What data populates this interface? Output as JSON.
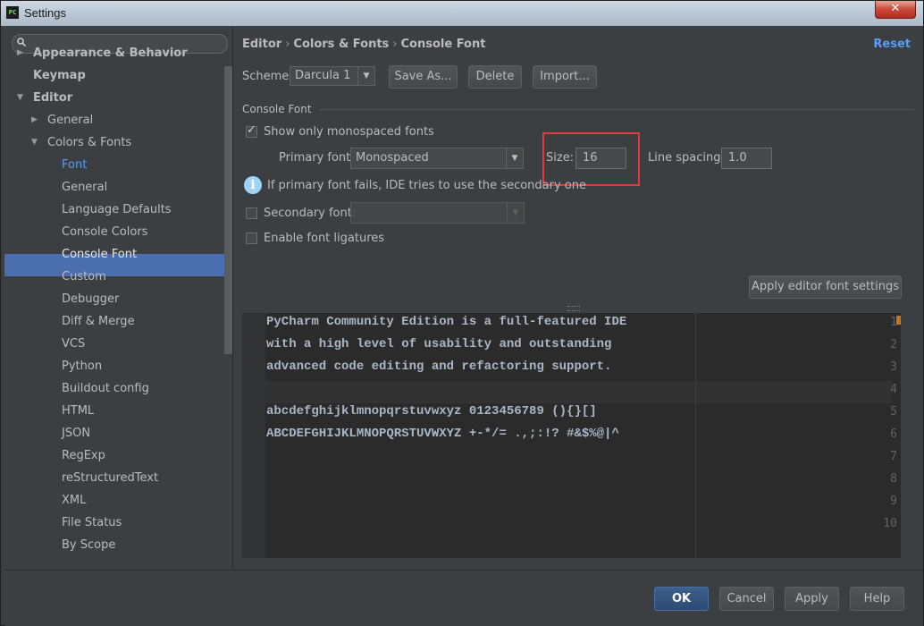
{
  "window": {
    "title": "Settings",
    "app_icon": "PC",
    "close_glyph": "✕"
  },
  "search": {
    "placeholder": "",
    "value": ""
  },
  "sidebar": {
    "items": [
      {
        "label": "Appearance & Behavior",
        "level": 0,
        "expanded": false,
        "bold": true
      },
      {
        "label": "Keymap",
        "level": 0,
        "bold": true
      },
      {
        "label": "Editor",
        "level": 0,
        "expanded": true,
        "bold": true
      },
      {
        "label": "General",
        "level": 1,
        "expanded": false
      },
      {
        "label": "Colors & Fonts",
        "level": 1,
        "expanded": true
      },
      {
        "label": "Font",
        "level": 2,
        "current": true
      },
      {
        "label": "General",
        "level": 2
      },
      {
        "label": "Language Defaults",
        "level": 2
      },
      {
        "label": "Console Colors",
        "level": 2
      },
      {
        "label": "Console Font",
        "level": 2,
        "selected": true
      },
      {
        "label": "Custom",
        "level": 2
      },
      {
        "label": "Debugger",
        "level": 2
      },
      {
        "label": "Diff & Merge",
        "level": 2
      },
      {
        "label": "VCS",
        "level": 2
      },
      {
        "label": "Python",
        "level": 2
      },
      {
        "label": "Buildout config",
        "level": 2
      },
      {
        "label": "HTML",
        "level": 2
      },
      {
        "label": "JSON",
        "level": 2
      },
      {
        "label": "RegExp",
        "level": 2
      },
      {
        "label": "reStructuredText",
        "level": 2
      },
      {
        "label": "XML",
        "level": 2
      },
      {
        "label": "File Status",
        "level": 2
      },
      {
        "label": "By Scope",
        "level": 2
      }
    ]
  },
  "breadcrumb": {
    "part1": "Editor",
    "part2": "Colors & Fonts",
    "part3": "Console Font",
    "sep": "›"
  },
  "reset_label": "Reset",
  "scheme": {
    "label": "Scheme:",
    "value": "Darcula 1",
    "save_as": "Save As...",
    "delete": "Delete",
    "import": "Import..."
  },
  "console_font": {
    "section_label": "Console Font",
    "monospaced_label": "Show only monospaced fonts",
    "monospaced_checked": true,
    "primary_label": "Primary font:",
    "primary_value": "Monospaced",
    "size_label": "Size:",
    "size_value": "16",
    "spacing_label": "Line spacing:",
    "spacing_value": "1.0",
    "info_text": "If primary font fails, IDE tries to use the secondary one",
    "secondary_label": "Secondary font:",
    "secondary_value": "",
    "ligatures_label": "Enable font ligatures",
    "ligatures_checked": false,
    "apply_editor_label": "Apply editor font settings"
  },
  "preview": {
    "lines": [
      "PyCharm Community Edition is a full-featured IDE",
      "with a high level of usability and outstanding",
      "advanced code editing and refactoring support.",
      "",
      "abcdefghijklmnopqrstuvwxyz 0123456789 (){}[]",
      "ABCDEFGHIJKLMNOPQRSTUVWXYZ +-*/= .,;:!? #&$%@|^",
      "",
      "",
      "",
      ""
    ],
    "line_numbers": [
      "1",
      "2",
      "3",
      "4",
      "5",
      "6",
      "7",
      "8",
      "9",
      "10"
    ]
  },
  "footer": {
    "ok": "OK",
    "cancel": "Cancel",
    "apply": "Apply",
    "help": "Help"
  },
  "colors": {
    "accent": "#589df6",
    "selection": "#4b6eaf",
    "highlight_box": "#e5373c",
    "background": "#3c3f41"
  }
}
